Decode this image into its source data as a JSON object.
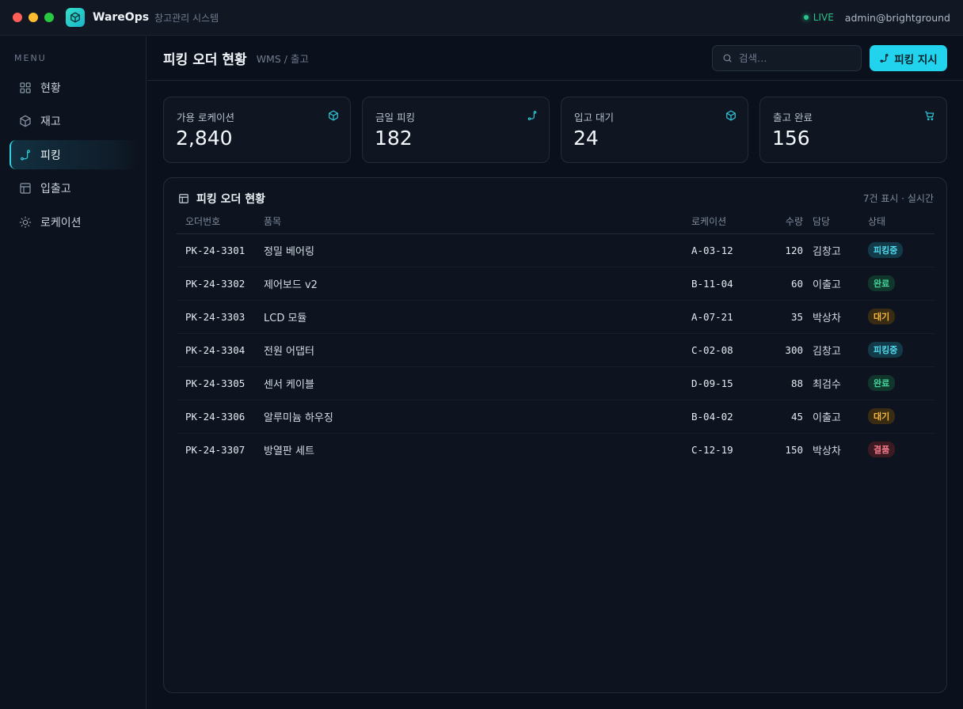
{
  "app": {
    "name": "WareOps",
    "subtitle": "창고관리 시스템",
    "status": "LIVE",
    "user": "admin@brightground"
  },
  "sidebar": {
    "menu_label": "MENU",
    "items": [
      {
        "label": "현황",
        "icon": "grid-icon"
      },
      {
        "label": "재고",
        "icon": "box-icon"
      },
      {
        "label": "피킹",
        "icon": "route-icon",
        "active": true
      },
      {
        "label": "입출고",
        "icon": "table-icon"
      },
      {
        "label": "로케이션",
        "icon": "sun-icon"
      }
    ]
  },
  "header": {
    "title": "피킹 오더 현황",
    "breadcrumb": "WMS / 출고",
    "search_placeholder": "검색…",
    "action_label": "피킹 지시"
  },
  "stats": [
    {
      "label": "가용 로케이션",
      "value": "2,840",
      "icon": "box-icon"
    },
    {
      "label": "금일 피킹",
      "value": "182",
      "icon": "route-icon"
    },
    {
      "label": "입고 대기",
      "value": "24",
      "icon": "box-icon"
    },
    {
      "label": "출고 완료",
      "value": "156",
      "icon": "cart-icon"
    }
  ],
  "table": {
    "title": "피킹 오더 현황",
    "meta": "7건 표시 · 실시간",
    "columns": [
      "오더번호",
      "품목",
      "로케이션",
      "수량",
      "담당",
      "상태"
    ],
    "rows": [
      {
        "order": "PK-24-3301",
        "item": "정밀 베어링",
        "loc": "A-03-12",
        "qty": "120",
        "owner": "김창고",
        "status": "피킹중",
        "kind": "pick"
      },
      {
        "order": "PK-24-3302",
        "item": "제어보드 v2",
        "loc": "B-11-04",
        "qty": "60",
        "owner": "이출고",
        "status": "완료",
        "kind": "done"
      },
      {
        "order": "PK-24-3303",
        "item": "LCD 모듈",
        "loc": "A-07-21",
        "qty": "35",
        "owner": "박상차",
        "status": "대기",
        "kind": "wait"
      },
      {
        "order": "PK-24-3304",
        "item": "전원 어댑터",
        "loc": "C-02-08",
        "qty": "300",
        "owner": "김창고",
        "status": "피킹중",
        "kind": "pick"
      },
      {
        "order": "PK-24-3305",
        "item": "센서 케이블",
        "loc": "D-09-15",
        "qty": "88",
        "owner": "최검수",
        "status": "완료",
        "kind": "done"
      },
      {
        "order": "PK-24-3306",
        "item": "알루미늄 하우징",
        "loc": "B-04-02",
        "qty": "45",
        "owner": "이출고",
        "status": "대기",
        "kind": "wait"
      },
      {
        "order": "PK-24-3307",
        "item": "방열판 세트",
        "loc": "C-12-19",
        "qty": "150",
        "owner": "박상차",
        "status": "결품",
        "kind": "miss"
      }
    ]
  },
  "colors": {
    "accent": "#22d3ee",
    "live": "#2bc48a",
    "background": "#0b111c"
  }
}
